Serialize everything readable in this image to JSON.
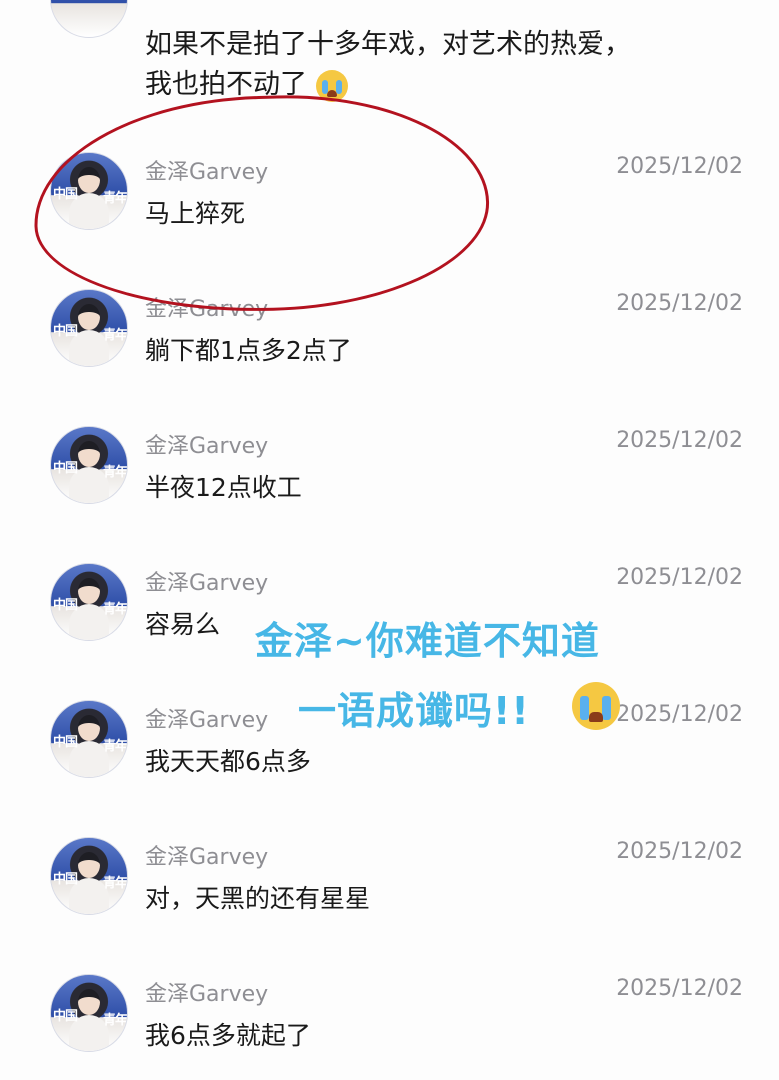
{
  "top_post": {
    "line1": "如果不是拍了十多年戏，对艺术的热爱，",
    "line2": "我也拍不动了",
    "emoji": "crying-face"
  },
  "posts": [
    {
      "username": "金泽Garvey",
      "date": "2025/12/02",
      "message": "马上猝死"
    },
    {
      "username": "金泽Garvey",
      "date": "2025/12/02",
      "message": "躺下都1点多2点了"
    },
    {
      "username": "金泽Garvey",
      "date": "2025/12/02",
      "message": "半夜12点收工"
    },
    {
      "username": "金泽Garvey",
      "date": "2025/12/02",
      "message": "容易么"
    },
    {
      "username": "金泽Garvey",
      "date": "2025/12/02",
      "message": "我天天都6点多"
    },
    {
      "username": "金泽Garvey",
      "date": "2025/12/02",
      "message": "对，天黑的还有星星"
    },
    {
      "username": "金泽Garvey",
      "date": "2025/12/02",
      "message": "我6点多就起了"
    }
  ],
  "avatar": {
    "tag_left": "中国",
    "tag_right": "青年"
  },
  "overlay": {
    "line1": "金泽~你难道不知道",
    "line2": "一语成谶吗!!",
    "color": "#47b7e6"
  },
  "highlight": {
    "color": "#b3121f"
  }
}
